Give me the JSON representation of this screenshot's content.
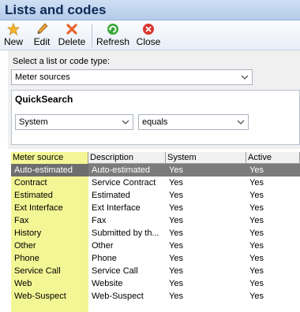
{
  "window": {
    "title": "Lists and codes"
  },
  "toolbar": {
    "new_label": "New",
    "edit_label": "Edit",
    "delete_label": "Delete",
    "refresh_label": "Refresh",
    "close_label": "Close"
  },
  "selector": {
    "label": "Select a list or code type:",
    "value": "Meter sources"
  },
  "quicksearch": {
    "title": "QuickSearch",
    "field_value": "System",
    "operator_value": "equals"
  },
  "grid": {
    "columns": [
      "Meter source",
      "Description",
      "System",
      "Active"
    ],
    "rows": [
      {
        "source": "Auto-estimated",
        "description": "Auto-estimated",
        "system": "Yes",
        "active": "Yes",
        "selected": true
      },
      {
        "source": "Contract",
        "description": "Service Contract",
        "system": "Yes",
        "active": "Yes"
      },
      {
        "source": "Estimated",
        "description": "Estimated",
        "system": "Yes",
        "active": "Yes"
      },
      {
        "source": "Ext Interface",
        "description": "Ext Interface",
        "system": "Yes",
        "active": "Yes"
      },
      {
        "source": "Fax",
        "description": "Fax",
        "system": "Yes",
        "active": "Yes"
      },
      {
        "source": "History",
        "description": "Submitted by th...",
        "system": "Yes",
        "active": "Yes"
      },
      {
        "source": "Other",
        "description": "Other",
        "system": "Yes",
        "active": "Yes"
      },
      {
        "source": "Phone",
        "description": "Phone",
        "system": "Yes",
        "active": "Yes"
      },
      {
        "source": "Service Call",
        "description": "Service Call",
        "system": "Yes",
        "active": "Yes"
      },
      {
        "source": "Web",
        "description": "Website",
        "system": "Yes",
        "active": "Yes"
      },
      {
        "source": "Web-Suspect",
        "description": "Web-Suspect",
        "system": "Yes",
        "active": "Yes"
      }
    ]
  },
  "icons": {
    "new": "star-icon",
    "edit": "pencil-icon",
    "delete": "x-icon",
    "refresh": "refresh-icon",
    "close": "close-circle-icon"
  },
  "colors": {
    "title_bar": "#b4cbea",
    "first_column_highlight": "#f3f694",
    "selected_row": "#7b7b7b"
  }
}
